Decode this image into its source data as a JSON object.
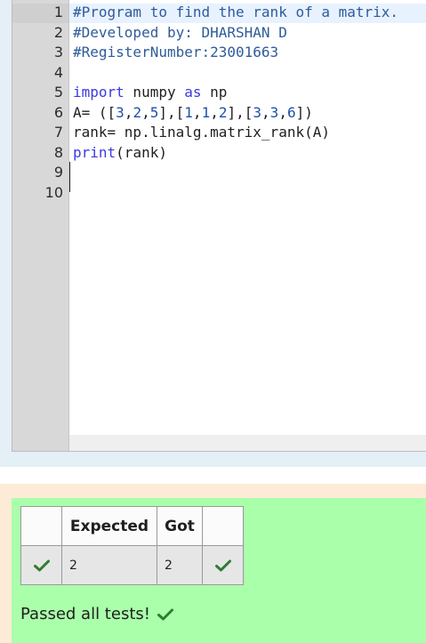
{
  "editor": {
    "line_numbers": [
      "1",
      "2",
      "3",
      "4",
      "5",
      "6",
      "7",
      "8",
      "9",
      "10"
    ],
    "lines": [
      {
        "parts": [
          {
            "t": "#Program to find the rank of a matrix.",
            "c": "comment"
          }
        ]
      },
      {
        "parts": [
          {
            "t": "#Developed by: DHARSHAN D",
            "c": "comment"
          }
        ]
      },
      {
        "parts": [
          {
            "t": "#RegisterNumber:23001663",
            "c": "comment"
          }
        ]
      },
      {
        "parts": []
      },
      {
        "parts": [
          {
            "t": "import",
            "c": "kw"
          },
          {
            "t": " numpy ",
            "c": ""
          },
          {
            "t": "as",
            "c": "kw"
          },
          {
            "t": " np",
            "c": ""
          }
        ]
      },
      {
        "parts": [
          {
            "t": "A= ([",
            "c": ""
          },
          {
            "t": "3",
            "c": "num"
          },
          {
            "t": ",",
            "c": ""
          },
          {
            "t": "2",
            "c": "num"
          },
          {
            "t": ",",
            "c": ""
          },
          {
            "t": "5",
            "c": "num"
          },
          {
            "t": "],[",
            "c": ""
          },
          {
            "t": "1",
            "c": "num"
          },
          {
            "t": ",",
            "c": ""
          },
          {
            "t": "1",
            "c": "num"
          },
          {
            "t": ",",
            "c": ""
          },
          {
            "t": "2",
            "c": "num"
          },
          {
            "t": "],[",
            "c": ""
          },
          {
            "t": "3",
            "c": "num"
          },
          {
            "t": ",",
            "c": ""
          },
          {
            "t": "3",
            "c": "num"
          },
          {
            "t": ",",
            "c": ""
          },
          {
            "t": "6",
            "c": "num"
          },
          {
            "t": "])",
            "c": ""
          }
        ]
      },
      {
        "parts": [
          {
            "t": "rank= np.linalg.matrix_rank(A)",
            "c": ""
          }
        ]
      },
      {
        "parts": [
          {
            "t": "print",
            "c": "kw"
          },
          {
            "t": "(rank)",
            "c": ""
          }
        ]
      },
      {
        "parts": []
      },
      {
        "parts": []
      }
    ]
  },
  "results": {
    "headers": [
      "",
      "Expected",
      "Got",
      ""
    ],
    "rows": [
      {
        "expected": "2",
        "got": "2",
        "status_icon": "check-icon"
      }
    ],
    "summary": "Passed all tests!",
    "colors": {
      "check": "#2f7d32",
      "panel": "#aaffaa",
      "outer": "#fdebd7"
    }
  }
}
